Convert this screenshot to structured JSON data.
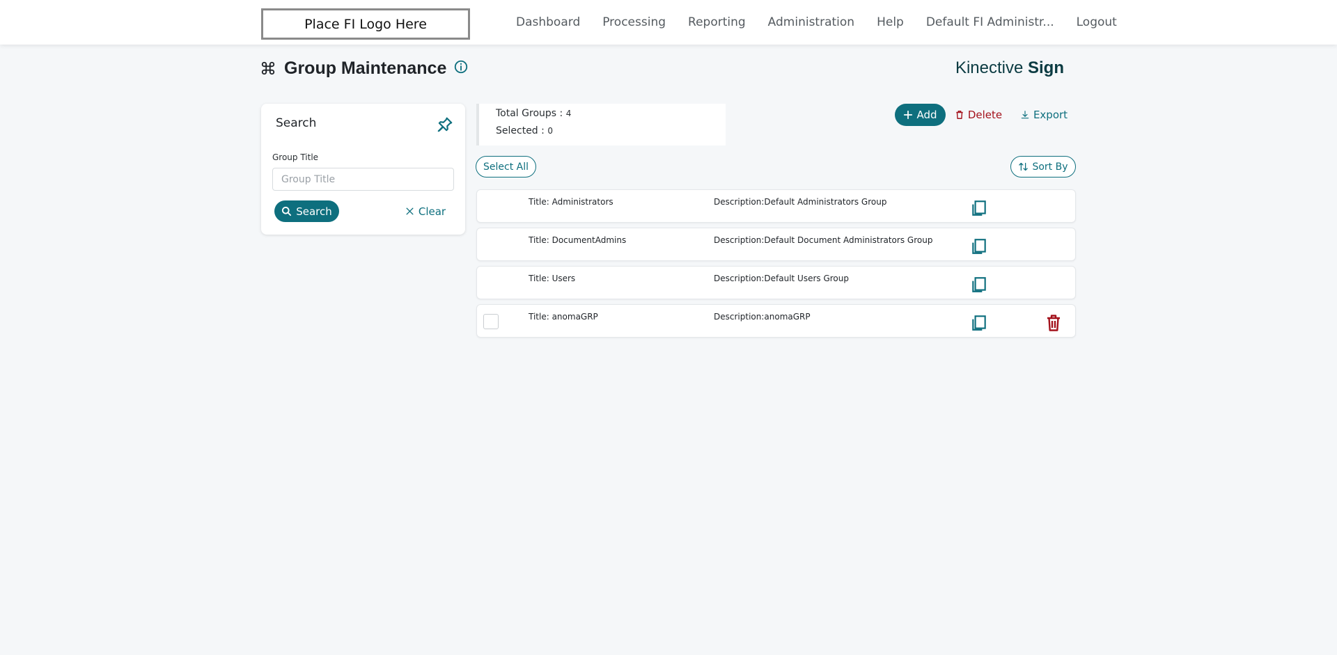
{
  "header": {
    "logo_text": "Place FI Logo Here",
    "nav": [
      {
        "label": "Dashboard"
      },
      {
        "label": "Processing"
      },
      {
        "label": "Reporting"
      },
      {
        "label": "Administration"
      },
      {
        "label": "Help"
      },
      {
        "label": "Default FI Administr..."
      },
      {
        "label": "Logout"
      }
    ]
  },
  "page": {
    "title": "Group Maintenance",
    "title_icon": "command-icon",
    "info_icon": "info-icon",
    "brand_light": "Kinective",
    "brand_bold": "Sign"
  },
  "search_panel": {
    "title": "Search",
    "pin_icon": "pin-icon",
    "field_label": "Group Title",
    "field_placeholder": "Group Title",
    "field_value": "",
    "search_label": "Search",
    "clear_label": "Clear"
  },
  "summary": {
    "total_label": "Total Groups : ",
    "total_value": "4",
    "selected_label": "Selected : ",
    "selected_value": "0"
  },
  "toolbar": {
    "add_label": "Add",
    "delete_label": "Delete",
    "export_label": "Export",
    "select_all_label": "Select All",
    "sort_label": "Sort By"
  },
  "groups": [
    {
      "title": "Title: Administrators",
      "description": "Description:Default Administrators Group",
      "selectable": false,
      "deletable": false
    },
    {
      "title": "Title: DocumentAdmins",
      "description": "Description:Default Document Administrators Group",
      "selectable": false,
      "deletable": false
    },
    {
      "title": "Title: Users",
      "description": "Description:Default Users Group",
      "selectable": false,
      "deletable": false
    },
    {
      "title": "Title: anomaGRP",
      "description": "Description:anomaGRP",
      "selectable": true,
      "deletable": true
    }
  ],
  "colors": {
    "accent": "#0e6f7e",
    "danger": "#a3111b",
    "background": "#f5f7f9"
  }
}
